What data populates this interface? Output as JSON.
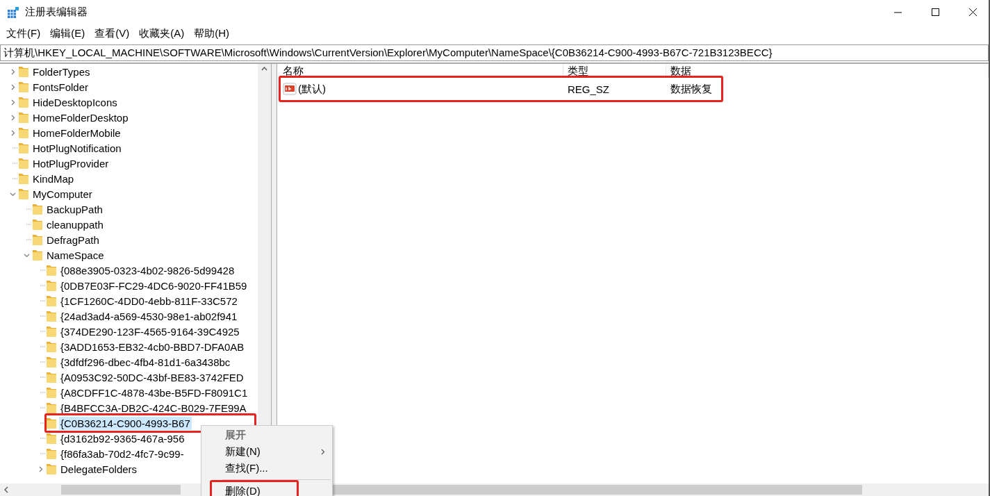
{
  "window": {
    "title": "注册表编辑器"
  },
  "menu": [
    "文件(F)",
    "编辑(E)",
    "查看(V)",
    "收藏夹(A)",
    "帮助(H)"
  ],
  "address": "计算机\\HKEY_LOCAL_MACHINE\\SOFTWARE\\Microsoft\\Windows\\CurrentVersion\\Explorer\\MyComputer\\NameSpace\\{C0B36214-C900-4993-B67C-721B3123BECC}",
  "tree": [
    {
      "label": "FolderTypes",
      "expanded": false,
      "selected": false
    },
    {
      "label": "FontsFolder",
      "expanded": false,
      "selected": false
    },
    {
      "label": "HideDesktopIcons",
      "expanded": false,
      "selected": false
    },
    {
      "label": "HomeFolderDesktop",
      "expanded": false,
      "selected": false
    },
    {
      "label": "HomeFolderMobile",
      "expanded": false,
      "selected": false
    },
    {
      "label": "HotPlugNotification",
      "selected": false
    },
    {
      "label": "HotPlugProvider",
      "selected": false
    },
    {
      "label": "KindMap",
      "selected": false
    },
    {
      "label": "MyComputer",
      "expanded": true,
      "selected": false,
      "children": [
        {
          "label": "BackupPath",
          "selected": false
        },
        {
          "label": "cleanuppath",
          "selected": false
        },
        {
          "label": "DefragPath",
          "selected": false
        },
        {
          "label": "NameSpace",
          "expanded": true,
          "selected": false,
          "children": [
            {
              "label": "{088e3905-0323-4b02-9826-5d99428",
              "selected": false
            },
            {
              "label": "{0DB7E03F-FC29-4DC6-9020-FF41B59",
              "selected": false
            },
            {
              "label": "{1CF1260C-4DD0-4ebb-811F-33C572",
              "selected": false
            },
            {
              "label": "{24ad3ad4-a569-4530-98e1-ab02f941",
              "selected": false
            },
            {
              "label": "{374DE290-123F-4565-9164-39C4925",
              "selected": false
            },
            {
              "label": "{3ADD1653-EB32-4cb0-BBD7-DFA0AB",
              "selected": false
            },
            {
              "label": "{3dfdf296-dbec-4fb4-81d1-6a3438bc",
              "selected": false
            },
            {
              "label": "{A0953C92-50DC-43bf-BE83-3742FED",
              "selected": false
            },
            {
              "label": "{A8CDFF1C-4878-43be-B5FD-F8091C1",
              "selected": false
            },
            {
              "label": "{B4BFCC3A-DB2C-424C-B029-7FE99A",
              "selected": false
            },
            {
              "label": "{C0B36214-C900-4993-B67",
              "selected": true,
              "highlighted": true
            },
            {
              "label": "{d3162b92-9365-467a-956",
              "selected": false
            },
            {
              "label": "{f86fa3ab-70d2-4fc7-9c99-",
              "selected": false
            },
            {
              "label": "DelegateFolders",
              "expanded": false,
              "selected": false
            }
          ]
        }
      ]
    }
  ],
  "values": {
    "columns": [
      "名称",
      "类型",
      "数据"
    ],
    "rows": [
      {
        "name": "(默认)",
        "type": "REG_SZ",
        "data": "数据恢复",
        "highlighted": true
      }
    ]
  },
  "context_menu": [
    {
      "label": "展开",
      "default": true,
      "disabled": true
    },
    {
      "label": "新建(N)",
      "default": false,
      "disabled": false,
      "submenu": true
    },
    {
      "label": "查找(F)...",
      "default": false,
      "disabled": false
    },
    {
      "label": "删除(D)",
      "default": false,
      "disabled": false,
      "separator_before": true,
      "highlighted": true
    }
  ]
}
